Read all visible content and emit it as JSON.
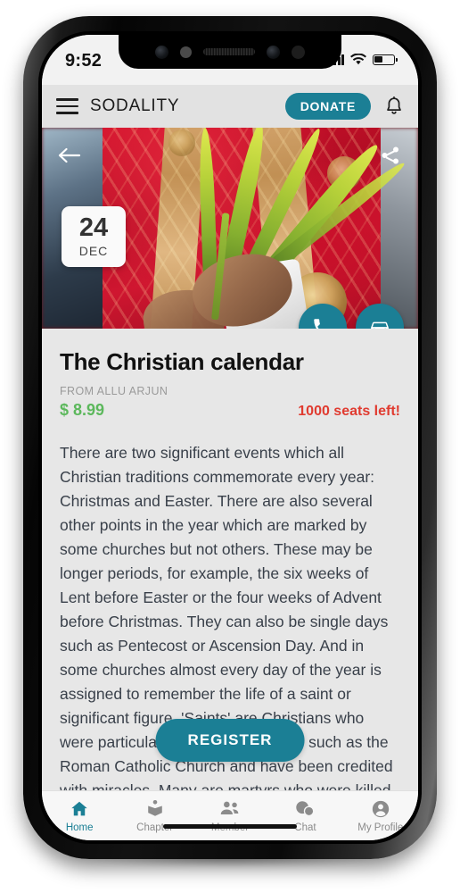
{
  "status_bar": {
    "time": "9:52",
    "battery_level": 42
  },
  "app_header": {
    "menu_icon": "hamburger-icon",
    "brand": "SODALITY",
    "donate_label": "DONATE",
    "bell_icon": "bell-icon"
  },
  "hero": {
    "back_icon": "back-arrow-icon",
    "share_icon": "share-icon",
    "date": {
      "day": "24",
      "month": "DEC"
    },
    "actions": [
      {
        "name": "call-button",
        "icon": "phone-icon"
      },
      {
        "name": "directions-button",
        "icon": "car-icon"
      }
    ]
  },
  "detail": {
    "title": "The Christian calendar",
    "from": "FROM ALLU ARJUN",
    "price": "$ 8.99",
    "seats": "1000 seats left!",
    "description": "There are two significant events which all Christian traditions commemorate every year: Christmas and Easter. There are also several other points in the year which are marked by some churches but not others. These may be longer periods, for example, the six weeks of Lent before Easter or the four weeks of Advent before Christmas. They can also be single days such as Pentecost or Ascension Day. And in some churches almost every day of the year is assigned to remember the life of a saint or significant figure. 'Saints' are Christians who were particularly by some traditions such as the Roman Catholic Church and have been credited with miracles. Many are martyrs who were killed for their faith. Some",
    "register_label": "REGISTER"
  },
  "bottom_nav": {
    "items": [
      {
        "label": "Home",
        "icon": "home-icon",
        "active": true
      },
      {
        "label": "Chapter",
        "icon": "book-icon",
        "active": false
      },
      {
        "label": "Member",
        "icon": "people-icon",
        "active": false
      },
      {
        "label": "Chat",
        "icon": "chat-bubbles-icon",
        "active": false
      },
      {
        "label": "My Profile",
        "icon": "person-circle-icon",
        "active": false
      }
    ]
  },
  "colors": {
    "accent_teal": "#1b7f95",
    "price_green": "#5cb85c",
    "seats_red": "#e03b30",
    "content_bg": "#e7e7e7"
  }
}
